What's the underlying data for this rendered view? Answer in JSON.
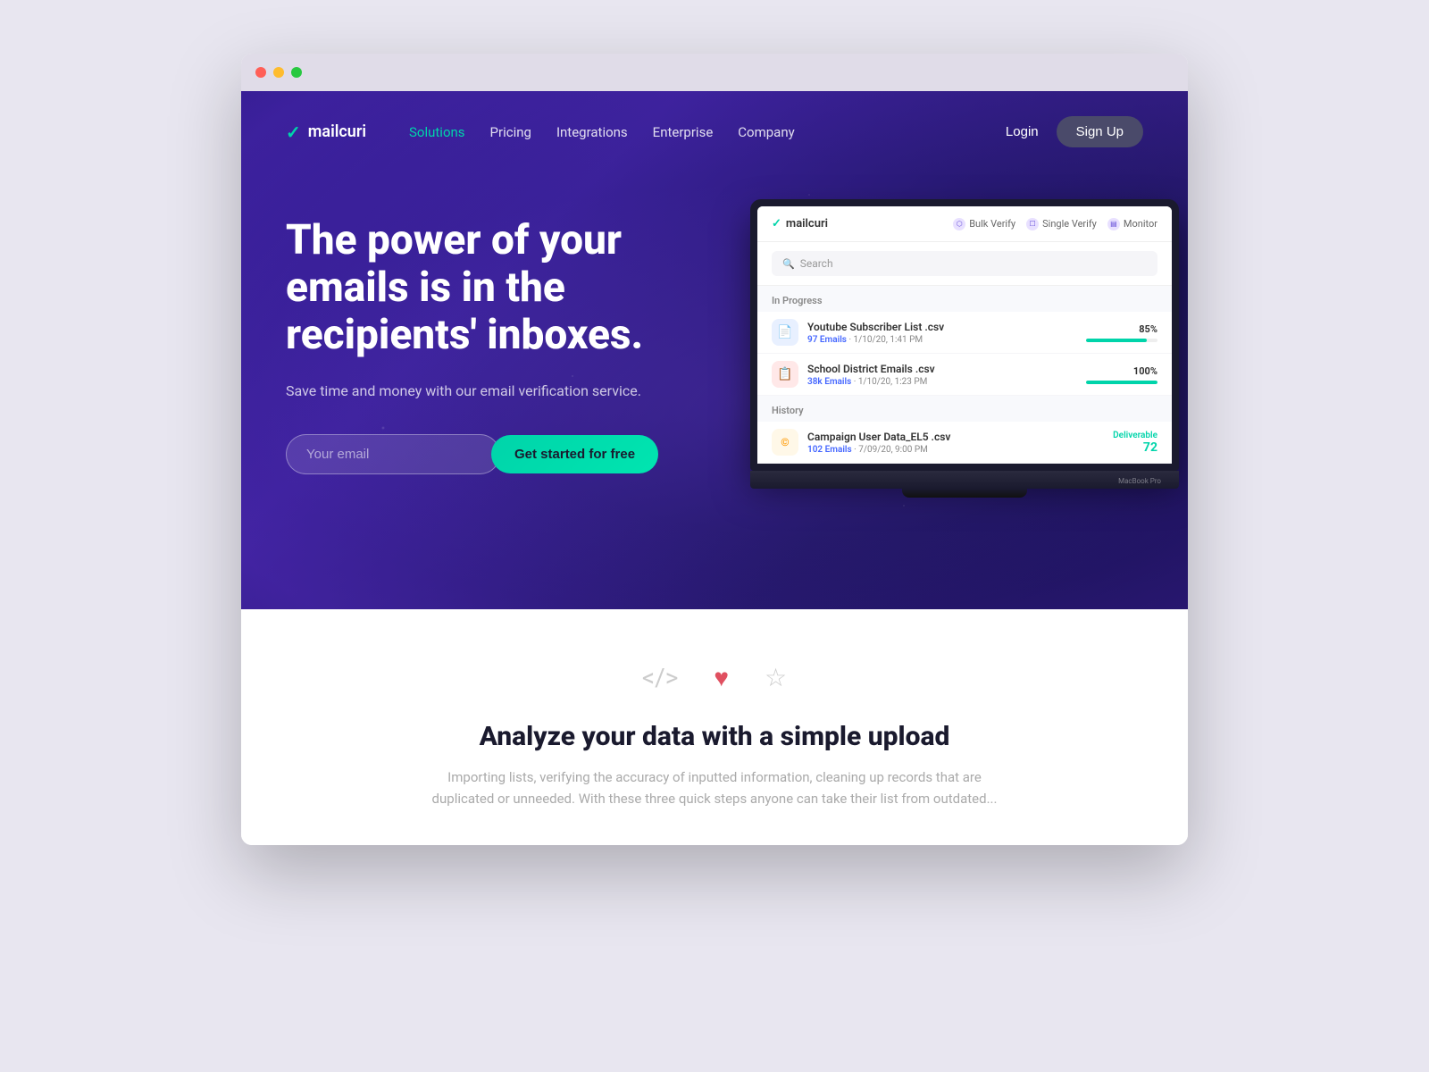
{
  "browser": {
    "dots": [
      "red",
      "yellow",
      "green"
    ]
  },
  "nav": {
    "logo_check": "✓",
    "logo_name": "mailcuri",
    "links": [
      {
        "label": "Solutions",
        "active": true
      },
      {
        "label": "Pricing"
      },
      {
        "label": "Integrations"
      },
      {
        "label": "Enterprise"
      },
      {
        "label": "Company"
      }
    ],
    "login": "Login",
    "signup": "Sign Up"
  },
  "hero": {
    "headline": "The power of your emails is in the recipients' inboxes.",
    "subtext": "Save time and money with our email verification service.",
    "email_placeholder": "Your email",
    "cta_label": "Get started for free"
  },
  "app_ui": {
    "logo_check": "✓",
    "logo_name": "mailcuri",
    "tabs": [
      {
        "label": "Bulk Verify"
      },
      {
        "label": "Single Verify"
      },
      {
        "label": "Monitor"
      }
    ],
    "search_placeholder": "Search",
    "in_progress_label": "In Progress",
    "items_in_progress": [
      {
        "name": "Youtube Subscriber List .csv",
        "count": "97 Emails",
        "date": "1/10/20, 1:41 PM",
        "progress": 85,
        "icon_type": "blue",
        "icon": "📄"
      },
      {
        "name": "School District Emails .csv",
        "count": "38k Emails",
        "date": "1/10/20, 1:23 PM",
        "progress": 100,
        "icon_type": "red",
        "icon": "📋"
      }
    ],
    "history_label": "History",
    "items_history": [
      {
        "name": "Campaign User Data_EL5 .csv",
        "count": "102 Emails",
        "date": "7/09/20, 9:00 PM",
        "deliverable_label": "Deliverable",
        "deliverable_count": "72",
        "icon_type": "yellow",
        "icon": "©"
      }
    ],
    "laptop_label": "MacBook Pro"
  },
  "features": {
    "icons": [
      {
        "symbol": "</>",
        "type": "code"
      },
      {
        "symbol": "♥",
        "type": "heart"
      },
      {
        "symbol": "☆",
        "type": "star"
      }
    ],
    "title": "Analyze your data with a simple upload",
    "description": "Importing lists, verifying the accuracy of inputted information, cleaning up records that are duplicated or unneeded. With these three quick steps anyone can take their list from outdated..."
  }
}
